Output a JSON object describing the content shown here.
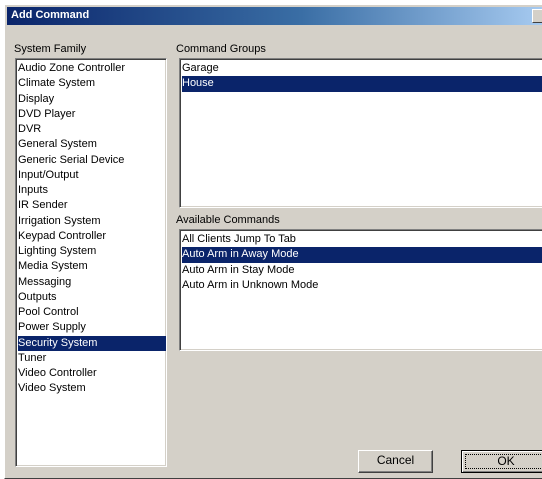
{
  "window": {
    "title": "Add Command"
  },
  "labels": {
    "system_family": "System Family",
    "command_groups": "Command Groups",
    "available_commands": "Available Commands"
  },
  "system_family": {
    "items": [
      "Audio Zone Controller",
      "Climate System",
      "Display",
      "DVD Player",
      "DVR",
      "General System",
      "Generic Serial Device",
      "Input/Output",
      "Inputs",
      "IR Sender",
      "Irrigation System",
      "Keypad Controller",
      "Lighting System",
      "Media System",
      "Messaging",
      "Outputs",
      "Pool Control",
      "Power Supply",
      "Security System",
      "Tuner",
      "Video Controller",
      "Video System"
    ],
    "selected": "Security System"
  },
  "command_groups": {
    "items": [
      "Garage",
      "House"
    ],
    "selected": "House"
  },
  "available_commands": {
    "items": [
      "All Clients Jump To Tab",
      "Auto Arm in Away Mode",
      "Auto Arm in Stay Mode",
      "Auto Arm in Unknown Mode"
    ],
    "selected": "Auto Arm in Away Mode"
  },
  "buttons": {
    "cancel": "Cancel",
    "ok": "OK"
  }
}
